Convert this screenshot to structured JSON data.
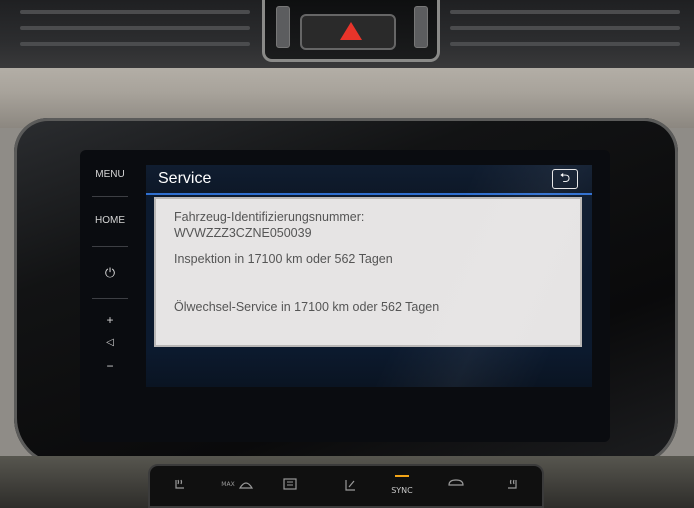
{
  "side_keys": {
    "menu": "MENU",
    "home": "HOME",
    "power_symbol": "⏻",
    "vol_up": "+",
    "vol_symbol": "◁",
    "vol_down": "−"
  },
  "screen": {
    "title": "Service",
    "back_symbol": "⮌",
    "vin_label": "Fahrzeug-Identifizierungsnummer:",
    "vin_value": "WVWZZZ3CZNE050039",
    "inspection": "Inspektion in 17100 km oder 562 Tagen",
    "oil_service": "Ölwechsel-Service in 17100 km oder 562 Tagen"
  },
  "climate": {
    "sync_label": "SYNC",
    "max_label": "MAX"
  },
  "colors": {
    "header_accent": "#2f6fd0",
    "hazard_red": "#e8342a",
    "sync_led": "#f2a417",
    "screen_bg": "#0c1a2e"
  },
  "icons": [
    "hazard-icon",
    "power-icon",
    "back-icon",
    "seat-heat-icon",
    "defrost-icon",
    "rear-defrost-icon",
    "seat-vent-icon",
    "recirculation-icon"
  ]
}
